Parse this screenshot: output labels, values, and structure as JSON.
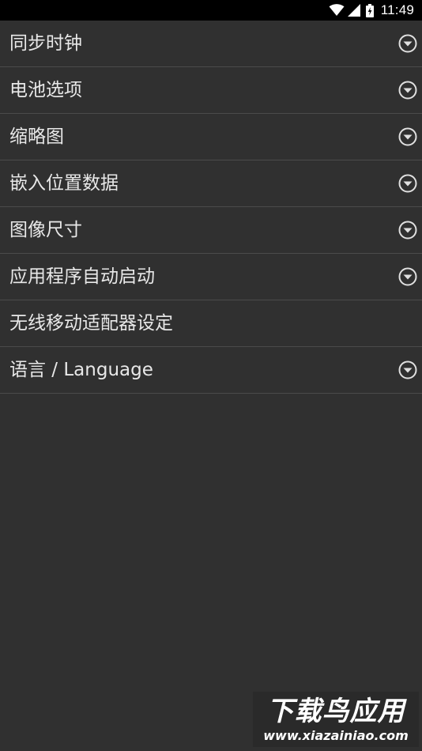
{
  "status_bar": {
    "time": "11:49",
    "icons": [
      "wifi-icon",
      "signal-icon",
      "battery-charging-icon"
    ]
  },
  "menu": {
    "items": [
      {
        "label": "同步时钟",
        "expandable": true
      },
      {
        "label": "电池选项",
        "expandable": true
      },
      {
        "label": "缩略图",
        "expandable": true
      },
      {
        "label": "嵌入位置数据",
        "expandable": true
      },
      {
        "label": "图像尺寸",
        "expandable": true
      },
      {
        "label": "应用程序自动启动",
        "expandable": true
      },
      {
        "label": "无线移动适配器设定",
        "expandable": false
      },
      {
        "label": "语言 / Language",
        "expandable": true
      }
    ],
    "expand_icon": "chevron-down-circle-icon"
  },
  "watermark": {
    "title": "下载鸟应用",
    "url": "www.xiazainiao.com"
  },
  "colors": {
    "background": "#303030",
    "status_bar": "#000000",
    "text": "#e8e8e8",
    "divider": "#4b4b4b"
  }
}
